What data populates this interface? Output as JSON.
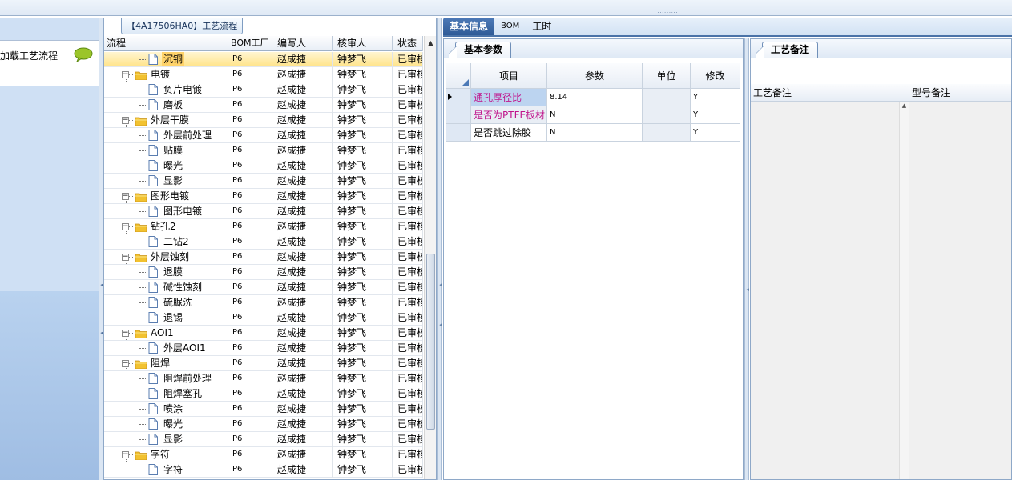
{
  "window": {
    "grip": "··········"
  },
  "nav": {
    "label": "加载工艺流程"
  },
  "tree": {
    "tab_title": "【4A17506HA0】工艺流程",
    "columns": [
      "流程",
      "BOM工厂",
      "编写人",
      "核审人",
      "状态"
    ],
    "rows": [
      {
        "name": "沉铜",
        "level": 1,
        "type": "item",
        "bom": "P6",
        "writer": "赵成捷",
        "reviewer": "钟梦飞",
        "status": "已审核",
        "selected": true
      },
      {
        "name": "电镀",
        "level": 0,
        "type": "group",
        "bom": "P6",
        "writer": "赵成捷",
        "reviewer": "钟梦飞",
        "status": "已审核"
      },
      {
        "name": "负片电镀",
        "level": 1,
        "type": "item",
        "bom": "P6",
        "writer": "赵成捷",
        "reviewer": "钟梦飞",
        "status": "已审核"
      },
      {
        "name": "磨板",
        "level": 1,
        "type": "item",
        "last": true,
        "bom": "P6",
        "writer": "赵成捷",
        "reviewer": "钟梦飞",
        "status": "已审核"
      },
      {
        "name": "外层干膜",
        "level": 0,
        "type": "group",
        "bom": "P6",
        "writer": "赵成捷",
        "reviewer": "钟梦飞",
        "status": "已审核"
      },
      {
        "name": "外层前处理",
        "level": 1,
        "type": "item",
        "bom": "P6",
        "writer": "赵成捷",
        "reviewer": "钟梦飞",
        "status": "已审核"
      },
      {
        "name": "贴膜",
        "level": 1,
        "type": "item",
        "bom": "P6",
        "writer": "赵成捷",
        "reviewer": "钟梦飞",
        "status": "已审核"
      },
      {
        "name": "曝光",
        "level": 1,
        "type": "item",
        "bom": "P6",
        "writer": "赵成捷",
        "reviewer": "钟梦飞",
        "status": "已审核"
      },
      {
        "name": "显影",
        "level": 1,
        "type": "item",
        "last": true,
        "bom": "P6",
        "writer": "赵成捷",
        "reviewer": "钟梦飞",
        "status": "已审核"
      },
      {
        "name": "图形电镀",
        "level": 0,
        "type": "group",
        "bom": "P6",
        "writer": "赵成捷",
        "reviewer": "钟梦飞",
        "status": "已审核"
      },
      {
        "name": "图形电镀",
        "level": 1,
        "type": "item",
        "last": true,
        "bom": "P6",
        "writer": "赵成捷",
        "reviewer": "钟梦飞",
        "status": "已审核"
      },
      {
        "name": "钻孔2",
        "level": 0,
        "type": "group",
        "bom": "P6",
        "writer": "赵成捷",
        "reviewer": "钟梦飞",
        "status": "已审核"
      },
      {
        "name": "二钻2",
        "level": 1,
        "type": "item",
        "last": true,
        "bom": "P6",
        "writer": "赵成捷",
        "reviewer": "钟梦飞",
        "status": "已审核"
      },
      {
        "name": "外层蚀刻",
        "level": 0,
        "type": "group",
        "bom": "P6",
        "writer": "赵成捷",
        "reviewer": "钟梦飞",
        "status": "已审核"
      },
      {
        "name": "退膜",
        "level": 1,
        "type": "item",
        "bom": "P6",
        "writer": "赵成捷",
        "reviewer": "钟梦飞",
        "status": "已审核"
      },
      {
        "name": "碱性蚀刻",
        "level": 1,
        "type": "item",
        "bom": "P6",
        "writer": "赵成捷",
        "reviewer": "钟梦飞",
        "status": "已审核"
      },
      {
        "name": "硫脲洗",
        "level": 1,
        "type": "item",
        "bom": "P6",
        "writer": "赵成捷",
        "reviewer": "钟梦飞",
        "status": "已审核"
      },
      {
        "name": "退锡",
        "level": 1,
        "type": "item",
        "last": true,
        "bom": "P6",
        "writer": "赵成捷",
        "reviewer": "钟梦飞",
        "status": "已审核"
      },
      {
        "name": "AOI1",
        "level": 0,
        "type": "group",
        "bom": "P6",
        "writer": "赵成捷",
        "reviewer": "钟梦飞",
        "status": "已审核"
      },
      {
        "name": "外层AOI1",
        "level": 1,
        "type": "item",
        "last": true,
        "bom": "P6",
        "writer": "赵成捷",
        "reviewer": "钟梦飞",
        "status": "已审核"
      },
      {
        "name": "阻焊",
        "level": 0,
        "type": "group",
        "bom": "P6",
        "writer": "赵成捷",
        "reviewer": "钟梦飞",
        "status": "已审核"
      },
      {
        "name": "阻焊前处理",
        "level": 1,
        "type": "item",
        "bom": "P6",
        "writer": "赵成捷",
        "reviewer": "钟梦飞",
        "status": "已审核"
      },
      {
        "name": "阻焊塞孔",
        "level": 1,
        "type": "item",
        "bom": "P6",
        "writer": "赵成捷",
        "reviewer": "钟梦飞",
        "status": "已审核"
      },
      {
        "name": "喷涂",
        "level": 1,
        "type": "item",
        "bom": "P6",
        "writer": "赵成捷",
        "reviewer": "钟梦飞",
        "status": "已审核"
      },
      {
        "name": "曝光",
        "level": 1,
        "type": "item",
        "bom": "P6",
        "writer": "赵成捷",
        "reviewer": "钟梦飞",
        "status": "已审核"
      },
      {
        "name": "显影",
        "level": 1,
        "type": "item",
        "last": true,
        "bom": "P6",
        "writer": "赵成捷",
        "reviewer": "钟梦飞",
        "status": "已审核"
      },
      {
        "name": "字符",
        "level": 0,
        "type": "group",
        "bom": "P6",
        "writer": "赵成捷",
        "reviewer": "钟梦飞",
        "status": "已审核"
      },
      {
        "name": "字符",
        "level": 1,
        "type": "item",
        "bom": "P6",
        "writer": "赵成捷",
        "reviewer": "钟梦飞",
        "status": "已审核"
      }
    ]
  },
  "top_tabs": [
    {
      "label": "基本信息",
      "active": true
    },
    {
      "label": "BOM",
      "active": false
    },
    {
      "label": "工时",
      "active": false
    }
  ],
  "params_pane": {
    "tab": "基本参数",
    "columns": [
      "项目",
      "参数",
      "单位",
      "修改"
    ],
    "rows": [
      {
        "item": "通孔厚径比",
        "param": "8.14",
        "unit": "",
        "modify": "Y",
        "current": true,
        "item_color": "#c0148c",
        "item_bg": "#bcd4f0"
      },
      {
        "item": "是否为PTFE板材",
        "param": "N",
        "unit": "",
        "modify": "Y",
        "current": false,
        "item_color": "#c0148c",
        "item_bg": "#e9eef5"
      },
      {
        "item": "是否跳过除胶",
        "param": "N",
        "unit": "",
        "modify": "Y",
        "current": false,
        "item_color": "#000000",
        "item_bg": "#ffffff"
      }
    ]
  },
  "notes_pane": {
    "tab": "工艺备注",
    "columns": [
      "工艺备注",
      "型号备注"
    ]
  },
  "colors": {
    "selection": "#ffd36a",
    "accent": "#2f5b96",
    "folder": "#f2c230"
  }
}
